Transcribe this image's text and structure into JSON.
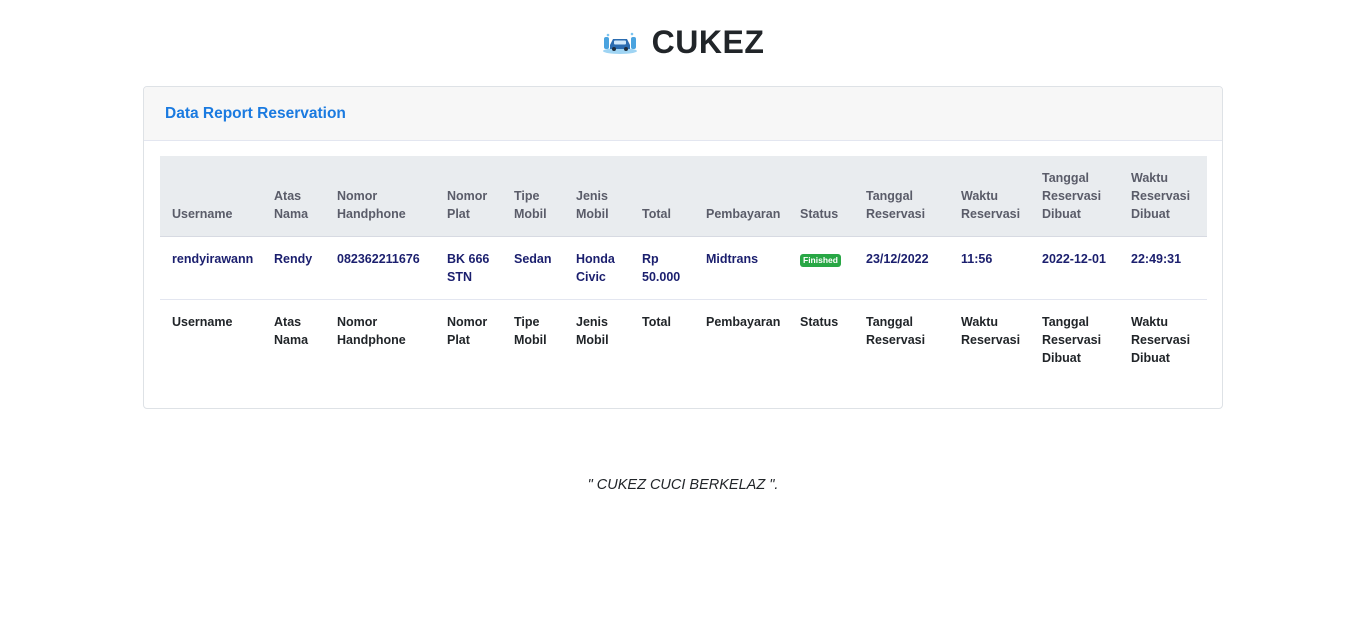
{
  "brand": {
    "name": "CUKEZ",
    "logo": "car-wash-icon"
  },
  "card": {
    "title": "Data Report Reservation"
  },
  "table": {
    "columns": [
      "Username",
      "Atas Nama",
      "Nomor Handphone",
      "Nomor Plat",
      "Tipe Mobil",
      "Jenis Mobil",
      "Total",
      "Pembayaran",
      "Status",
      "Tanggal Reservasi",
      "Waktu Reservasi",
      "Tanggal Reservasi Dibuat",
      "Waktu Reservasi Dibuat"
    ],
    "rows": [
      {
        "username": "rendyirawann",
        "atas_nama": "Rendy",
        "nomor_handphone": "082362211676",
        "nomor_plat": "BK 666 STN",
        "tipe_mobil": "Sedan",
        "jenis_mobil": "Honda Civic",
        "total": "Rp 50.000",
        "pembayaran": "Midtrans",
        "status": "Finished",
        "tanggal_reservasi": "23/12/2022",
        "waktu_reservasi": "11:56",
        "tanggal_dibuat": "2022-12-01",
        "waktu_dibuat": "22:49:31"
      }
    ],
    "footer": [
      "Username",
      "Atas Nama",
      "Nomor Handphone",
      "Nomor Plat",
      "Tipe Mobil",
      "Jenis Mobil",
      "Total",
      "Pembayaran",
      "Status",
      "Tanggal Reservasi",
      "Waktu Reservasi",
      "Tanggal Reservasi Dibuat",
      "Waktu Reservasi Dibuat"
    ]
  },
  "colors": {
    "accent": "#1a7ae0",
    "status_finished": "#28a745",
    "row_text": "#1b1f6e"
  },
  "footer_quote": "\" CUKEZ CUCI BERKELAZ \"."
}
